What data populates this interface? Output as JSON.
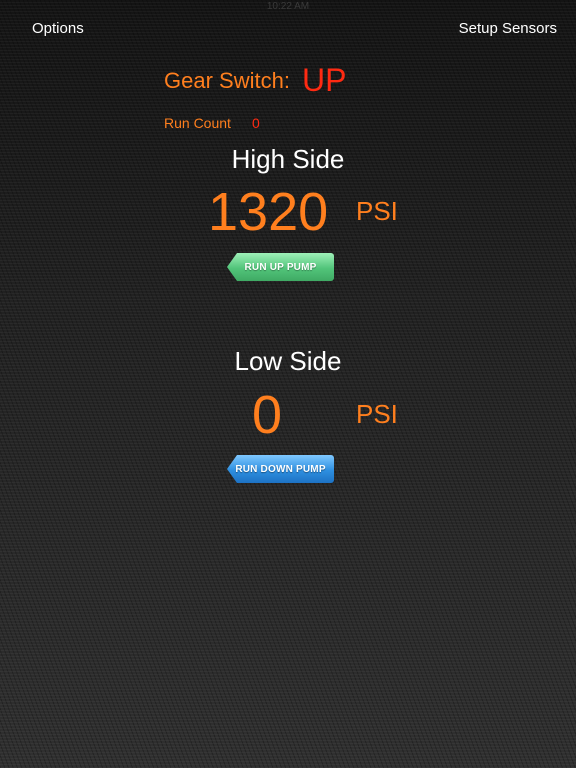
{
  "status_bar": {
    "time": "10:22 AM"
  },
  "nav": {
    "left_label": "Options",
    "right_label": "Setup Sensors"
  },
  "gear_switch": {
    "label": "Gear Switch:",
    "value": "UP"
  },
  "run_count": {
    "label": "Run Count",
    "value": "0"
  },
  "high_side": {
    "title": "High Side",
    "value": "1320",
    "unit": "PSI",
    "button_label": "RUN UP PUMP"
  },
  "low_side": {
    "title": "Low Side",
    "value": "0",
    "unit": "PSI",
    "button_label": "RUN DOWN PUMP"
  },
  "colors": {
    "orange": "#ff7f1e",
    "red": "#ff2a12",
    "green_button": "#52c47a",
    "blue_button": "#2e8fe0"
  }
}
